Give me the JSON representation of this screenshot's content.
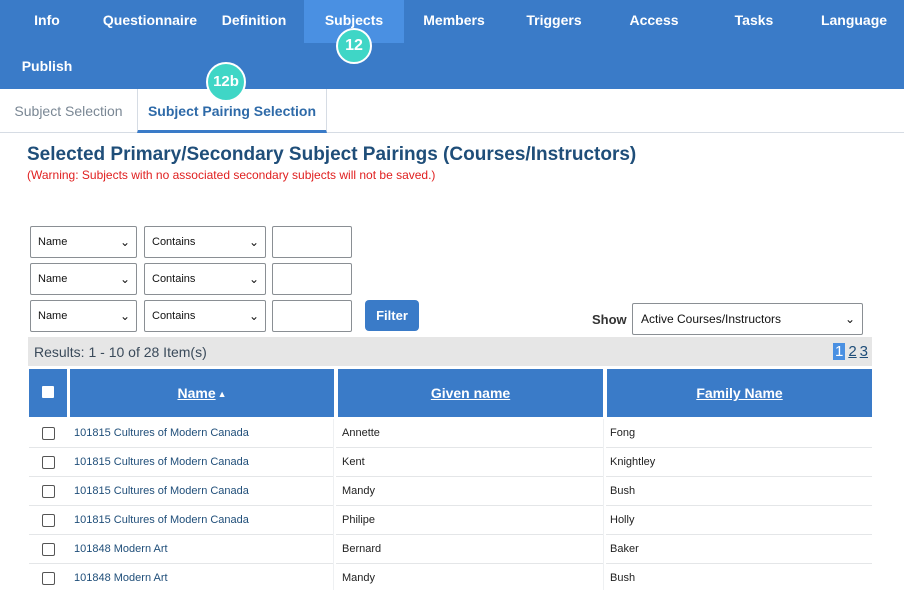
{
  "nav": {
    "tabs": [
      {
        "label": "Info"
      },
      {
        "label": "Questionnaire"
      },
      {
        "label": "Definition"
      },
      {
        "label": "Subjects"
      },
      {
        "label": "Members"
      },
      {
        "label": "Triggers"
      },
      {
        "label": "Access"
      },
      {
        "label": "Tasks"
      },
      {
        "label": "Language"
      },
      {
        "label": "Publish"
      }
    ],
    "active_tab": "Subjects",
    "badge_main": "12",
    "badge_sub": "12b"
  },
  "subtabs": [
    {
      "label": "Subject Selection"
    },
    {
      "label": "Subject Pairing Selection"
    }
  ],
  "page": {
    "title": "Selected Primary/Secondary Subject Pairings (Courses/Instructors)",
    "warning": "(Warning: Subjects with no associated secondary subjects will not be saved.)"
  },
  "filters": [
    {
      "field": "Name",
      "operator": "Contains",
      "value": ""
    },
    {
      "field": "Name",
      "operator": "Contains",
      "value": ""
    },
    {
      "field": "Name",
      "operator": "Contains",
      "value": ""
    }
  ],
  "filter_button": "Filter",
  "show": {
    "label": "Show",
    "selected": "Active Courses/Instructors"
  },
  "results": {
    "text": "Results: 1 - 10 of 28 Item(s)",
    "pages": [
      "1",
      "2",
      "3"
    ],
    "current_page": "1"
  },
  "table": {
    "headers": [
      "Name",
      "Given name",
      "Family Name"
    ],
    "sort_indicator": "▲",
    "rows": [
      {
        "name": "101815 Cultures of Modern Canada",
        "given": "Annette",
        "family": "Fong"
      },
      {
        "name": "101815 Cultures of Modern Canada",
        "given": "Kent",
        "family": "Knightley"
      },
      {
        "name": "101815 Cultures of Modern Canada",
        "given": "Mandy",
        "family": "Bush"
      },
      {
        "name": "101815 Cultures of Modern Canada",
        "given": "Philipe",
        "family": "Holly"
      },
      {
        "name": "101848 Modern Art",
        "given": "Bernard",
        "family": "Baker"
      },
      {
        "name": "101848 Modern Art",
        "given": "Mandy",
        "family": "Bush"
      }
    ]
  },
  "colors": {
    "nav_bg": "#3a7bc8",
    "active_tab_bg": "#4a90e2",
    "badge": "#3fd6c6",
    "title": "#1f4e79",
    "warning": "#e02020",
    "header_bg": "#3a7bc8"
  },
  "icons": {
    "select_chevron": "chevron-down-icon",
    "sort": "sort-ascending-icon",
    "checkbox": "checkbox-icon"
  }
}
